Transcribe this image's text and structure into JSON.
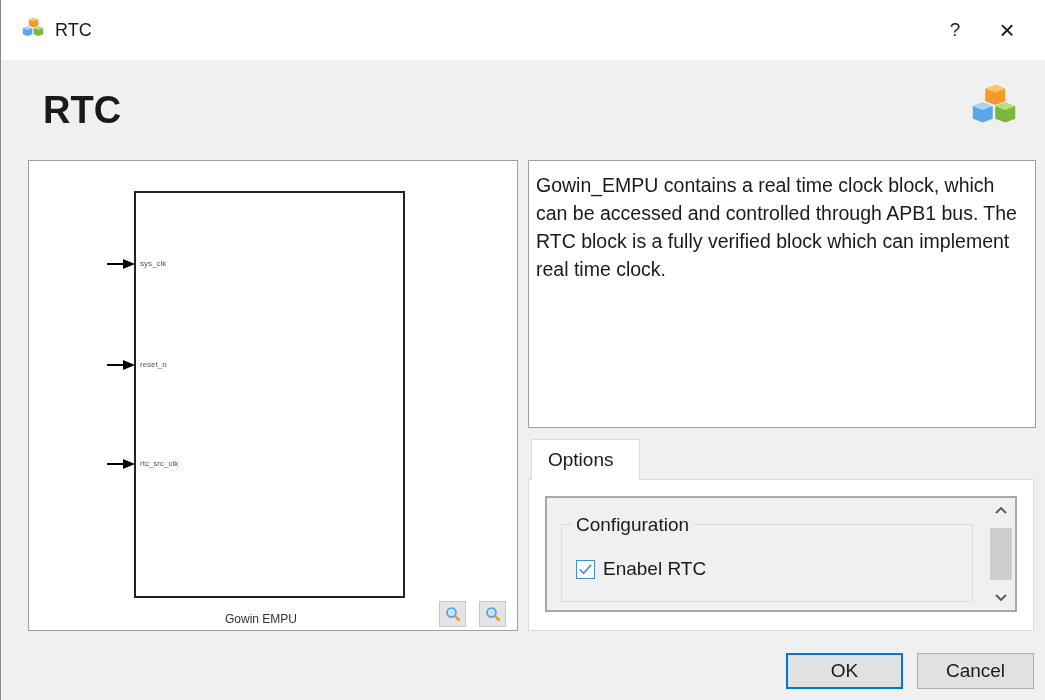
{
  "window": {
    "title": "RTC",
    "help": "?",
    "close": "×"
  },
  "header": {
    "title": "RTC"
  },
  "diagram": {
    "block_label": "Gowin EMPU",
    "pins": [
      {
        "name": "sys_clk"
      },
      {
        "name": "reset_n"
      },
      {
        "name": "rtc_src_clk"
      }
    ]
  },
  "description": "Gowin_EMPU contains a real time clock block, which can be accessed and controlled through APB1 bus. The RTC block is a fully verified block which can implement real time clock.",
  "tabs": [
    {
      "label": "Options",
      "selected": true
    }
  ],
  "options": {
    "group": "Configuration",
    "items": [
      {
        "label": "Enabel RTC",
        "checked": true
      }
    ]
  },
  "buttons": [
    {
      "label": "OK",
      "default": true
    },
    {
      "label": "Cancel",
      "default": false
    }
  ]
}
